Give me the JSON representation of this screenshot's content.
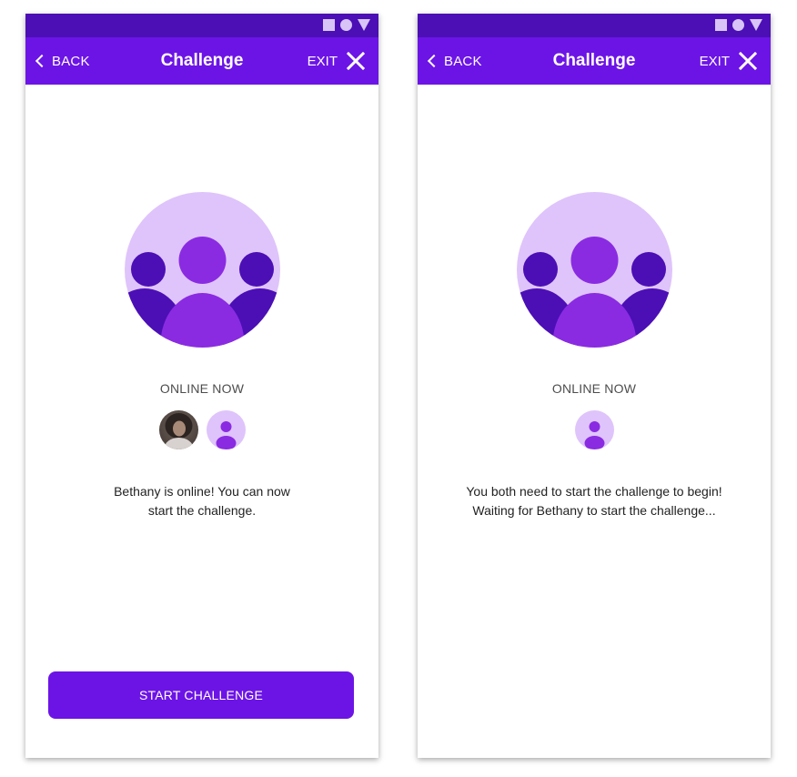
{
  "colors": {
    "status_bar": "#4b0fb5",
    "app_bar": "#6c14e6",
    "hero_bg": "#dfc4fb",
    "hero_side_person": "#4b0fb5",
    "hero_center_person": "#8a2be2",
    "button": "#6c14e6"
  },
  "screens": [
    {
      "status_icons": [
        "square-icon",
        "circle-icon",
        "triangle-icon"
      ],
      "app_bar": {
        "back_label": "BACK",
        "title": "Challenge",
        "exit_label": "EXIT"
      },
      "hero_icon": "group-people-icon",
      "online_label": "ONLINE NOW",
      "avatars": [
        "user-photo-avatar",
        "user-placeholder-avatar"
      ],
      "message": [
        "Bethany is online! You can now",
        "start the challenge."
      ],
      "button_label": "START CHALLENGE"
    },
    {
      "status_icons": [
        "square-icon",
        "circle-icon",
        "triangle-icon"
      ],
      "app_bar": {
        "back_label": "BACK",
        "title": "Challenge",
        "exit_label": "EXIT"
      },
      "hero_icon": "group-people-icon",
      "online_label": "ONLINE NOW",
      "avatars": [
        "user-placeholder-avatar"
      ],
      "message": [
        "You both need to start the challenge to begin!",
        "Waiting for Bethany to start the challenge..."
      ]
    }
  ]
}
